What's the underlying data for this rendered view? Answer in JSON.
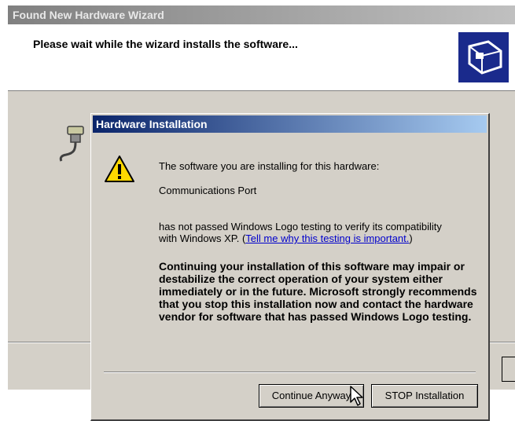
{
  "wizard": {
    "title": "Found New Hardware Wizard",
    "header_text": "Please wait while the wizard installs the software..."
  },
  "dialog": {
    "title": "Hardware Installation",
    "line1": "The software you are installing for this hardware:",
    "device": "Communications Port",
    "line3": "has not passed Windows Logo testing to verify its compatibility",
    "line4_prefix": "with Windows XP. (",
    "link": "Tell me why this testing is important.",
    "line4_suffix": ")",
    "warning": "Continuing your installation of this software may impair or destabilize the correct operation of your system either immediately or in the future. Microsoft strongly recommends that you stop this installation now and contact the hardware vendor for software that has passed Windows Logo testing.",
    "continue_label": "Continue Anyway",
    "stop_label": "STOP Installation"
  }
}
